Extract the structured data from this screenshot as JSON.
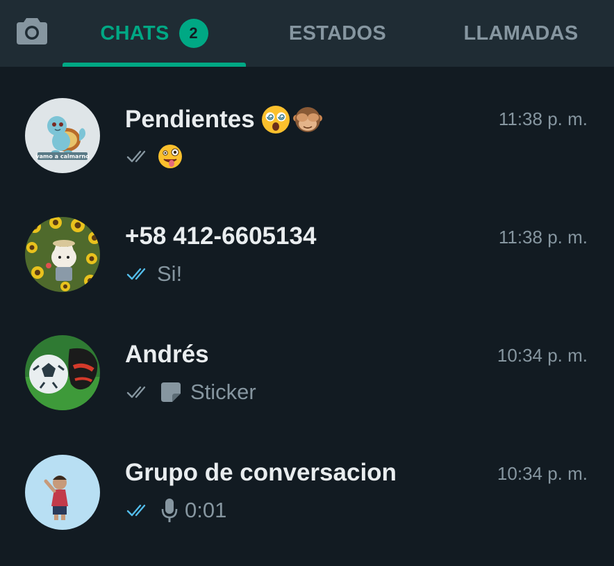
{
  "header": {
    "tabs": {
      "chats": {
        "label": "CHATS",
        "badge": "2"
      },
      "estados": {
        "label": "ESTADOS"
      },
      "llamadas": {
        "label": "LLAMADAS"
      }
    },
    "icons": {
      "camera": "camera-icon"
    },
    "accent_color": "#00a884"
  },
  "chats": [
    {
      "name": "Pendientes",
      "name_emoji": "dizzy-face-emoji, see-no-evil-monkey-emoji",
      "time": "11:38 p. m.",
      "preview_text": "",
      "preview_emoji": "zany-face-emoji",
      "ticks": "read-pending-grey",
      "avatar_caption": "vamo a calmarno"
    },
    {
      "name": "+58 412-6605134",
      "time": "11:38 p. m.",
      "preview_text": "Si!",
      "ticks": "read-blue"
    },
    {
      "name": "Andrés",
      "time": "10:34 p. m.",
      "preview_text": "Sticker",
      "ticks": "delivered-grey",
      "preview_icon": "sticker-icon"
    },
    {
      "name": "Grupo de conversacion",
      "time": "10:34 p. m.",
      "preview_text": "0:01",
      "ticks": "read-blue",
      "preview_icon": "mic-icon"
    }
  ],
  "colors": {
    "background": "#121b22",
    "topbar": "#1f2c34",
    "primary_text": "#e9edef",
    "secondary_text": "#8696a0",
    "read_ticks": "#53bdeb"
  }
}
